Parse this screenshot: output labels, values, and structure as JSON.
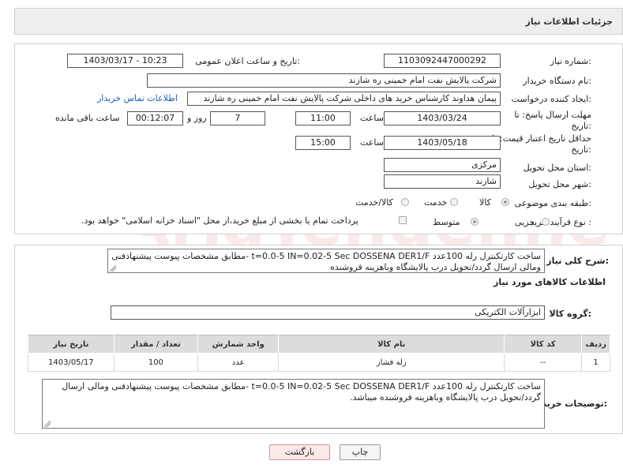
{
  "header": {
    "title": "جزئیات اطلاعات نیاز"
  },
  "form": {
    "need_number_label": "شماره نیاز:",
    "need_number_value": "1103092447000292",
    "announce_label": "تاریخ و ساعت اعلان عمومی:",
    "announce_value": "1403/03/17 - 10:23",
    "buyer_org_label": "نام دستگاه خریدار:",
    "buyer_org_value": "شرکت پالایش نفت امام خمینی  ره  شازند",
    "requester_label": "ایجاد کننده درخواست:",
    "requester_value": "پیمان هداوند کارشناس خرید های داخلی  شرکت پالایش نفت امام خمینی  ره  شازند",
    "contact_link": "اطلاعات تماس خریدار",
    "reply_deadline_label_1": "مهلت ارسال پاسخ: تا",
    "reply_deadline_label_2": "تاریخ:",
    "reply_date": "1403/03/24",
    "hour_label": "ساعت",
    "reply_time": "11:00",
    "days_value": "7",
    "day_and_label": "روز و",
    "remaining_time": "00:12:07",
    "remaining_label": "ساعت باقی مانده",
    "validity_label_1": "حداقل تاریخ اعتبار قیمت: تا",
    "validity_label_2": "تاریخ:",
    "validity_date": "1403/05/18",
    "validity_hour_label": "ساعت",
    "validity_time": "15:00",
    "province_label": "استان محل تحویل:",
    "province_value": "مرکزی",
    "city_label": "شهر محل تحویل:",
    "city_value": "شازند",
    "category_label": "طبقه بندی موضوعی:",
    "category_options": [
      "کالا",
      "خدمت",
      "کالا/خدمت"
    ],
    "process_label": "نوع فرآیند خرید :",
    "process_options": [
      "جزیی",
      "متوسط"
    ],
    "payment_note": "پرداخت تمام یا بخشی از مبلغ خرید،از محل \"اسناد خزانه اسلامی\" خواهد بود."
  },
  "details": {
    "general_desc_label": "شرح کلی نیاز:",
    "general_desc_value": "ساخت کارتکنترل رله 100عدد t=0.0-5 IN=0.02-5 Sec DOSSENA DER1/F -مطابق مشخصات پیوست پیشنهادفنی ومالی ارسال گردد/تحویل درب پالایشگاه وباهزینه فروشنده",
    "goods_info_title": "اطلاعات کالاهای مورد نیاز",
    "goods_group_label": "گروه کالا:",
    "goods_group_value": "ابزارآلات الکتریکی",
    "table": {
      "headers": [
        "ردیف",
        "کد کالا",
        "نام کالا",
        "واحد شمارش",
        "تعداد / مقدار",
        "تاریخ نیاز"
      ],
      "rows": [
        [
          "1",
          "--",
          "رله فشار",
          "عدد",
          "100",
          "1403/05/17"
        ]
      ]
    },
    "buyer_notes_label": "توضیحات خریدار:",
    "buyer_notes_value": "ساخت کارتکنترل رله 100عدد t=0.0-5 IN=0.02-5 Sec DOSSENA DER1/F -مطابق مشخصات پیوست پیشنهادفنی ومالی ارسال گردد/تحویل درب پالایشگاه وباهزینه فروشنده میباشد."
  },
  "buttons": {
    "print": "چاپ",
    "back": "بازگشت"
  },
  "watermark_text": "AriaTender.neT",
  "colors": {
    "link": "#1a5fb4",
    "back_bg": "#fde8e8",
    "header_bg": "#eeeeee"
  }
}
